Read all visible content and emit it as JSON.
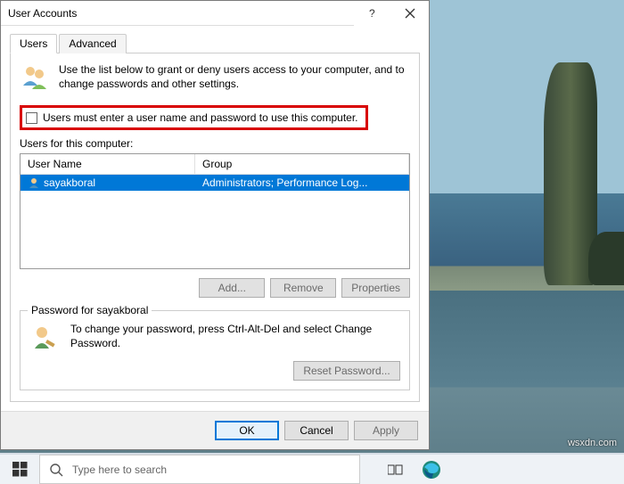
{
  "dialog": {
    "title": "User Accounts",
    "tabs": {
      "users": "Users",
      "advanced": "Advanced"
    },
    "intro": "Use the list below to grant or deny users access to your computer, and to change passwords and other settings.",
    "checkbox_label": "Users must enter a user name and password to use this computer.",
    "users_for_computer": "Users for this computer:",
    "columns": {
      "name": "User Name",
      "group": "Group"
    },
    "row": {
      "name": "sayakboral",
      "group": "Administrators; Performance Log..."
    },
    "buttons": {
      "add": "Add...",
      "remove": "Remove",
      "properties": "Properties"
    },
    "password_group_title": "Password for sayakboral",
    "password_text": "To change your password, press Ctrl-Alt-Del and select Change Password.",
    "reset_btn": "Reset Password...",
    "footer": {
      "ok": "OK",
      "cancel": "Cancel",
      "apply": "Apply"
    }
  },
  "taskbar": {
    "search_placeholder": "Type here to search"
  },
  "watermark": "wsxdn.com"
}
